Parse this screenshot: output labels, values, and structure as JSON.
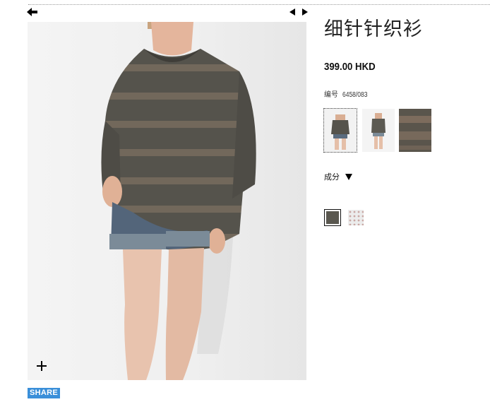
{
  "product": {
    "title": "细针针织衫",
    "price": "399.00 HKD",
    "ref_label": "编号",
    "ref_value": "6458/083",
    "composition_label": "成分"
  },
  "share": {
    "label": "SHARE"
  },
  "colors": {
    "share_blue": "#3a8fd9",
    "garment_gray": "#5a5850",
    "swatch_2": "#ececec"
  },
  "icons": {
    "back": "arrow-left-icon",
    "prev": "triangle-left-icon",
    "next": "triangle-right-icon",
    "zoom": "plus-icon",
    "composition_toggle": "triangle-down-icon"
  }
}
